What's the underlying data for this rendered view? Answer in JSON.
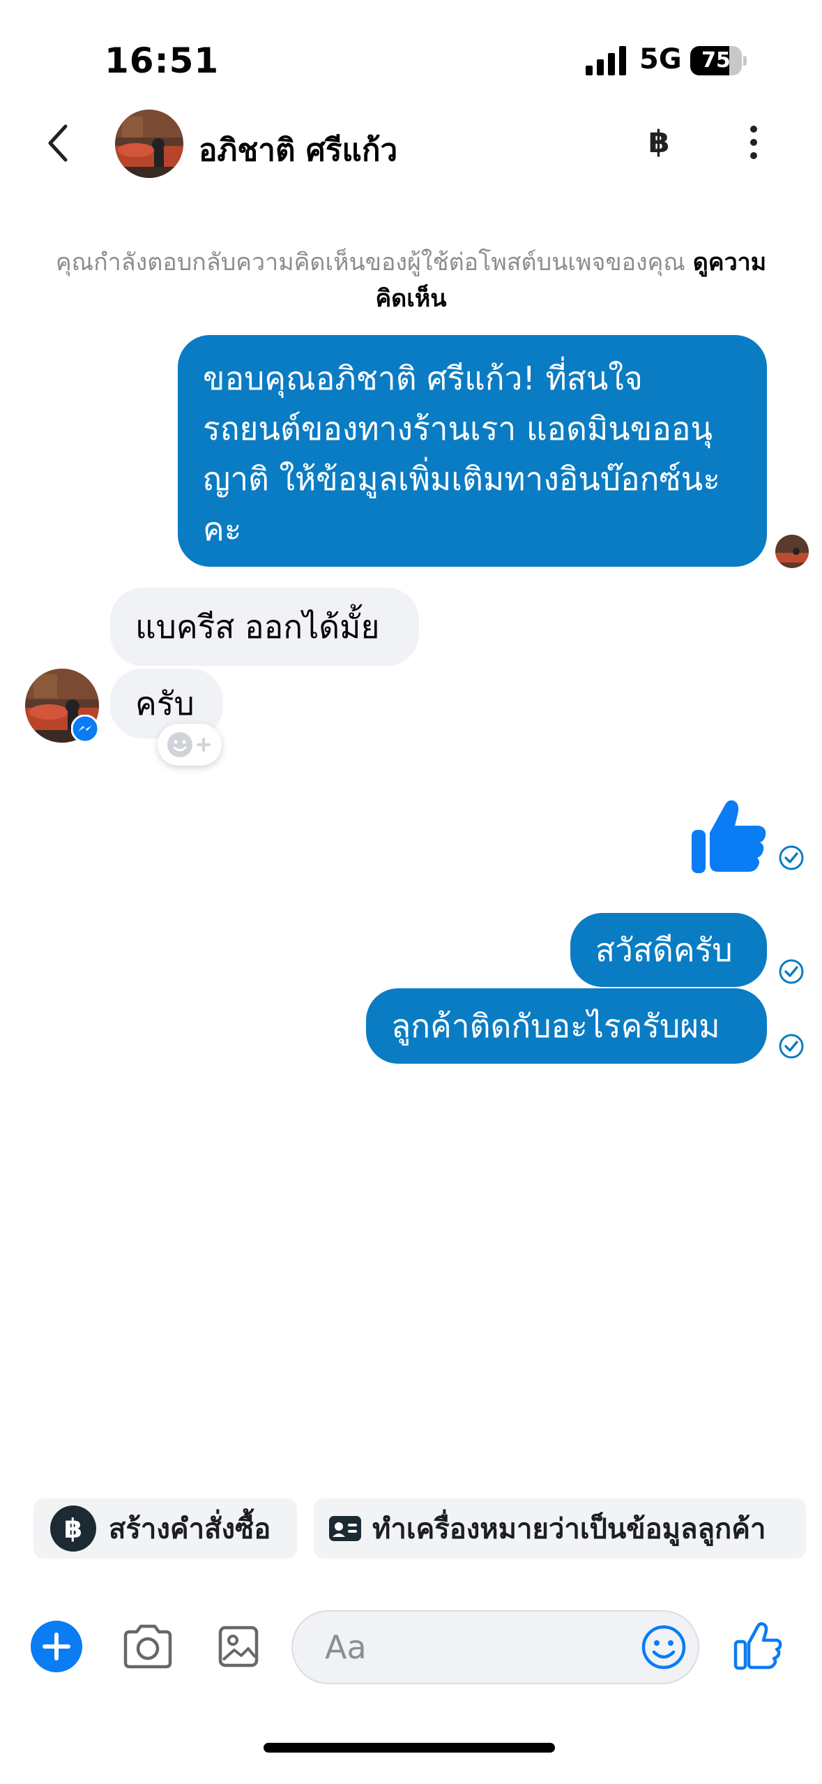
{
  "status_bar": {
    "time": "16:51",
    "network": "5G",
    "battery": "75",
    "battery_level": 0.75
  },
  "header": {
    "contact_name": "อภิชาติ ศรีแก้ว",
    "currency_symbol": "฿"
  },
  "notice": {
    "text": "คุณกำลังตอบกลับความคิดเห็นของผู้ใช้ต่อโพสต์บนเพจของคุณ ",
    "link": "ดูความคิดเห็น"
  },
  "messages": [
    {
      "direction": "outgoing",
      "text": "ขอบคุณอภิชาติ ศรีแก้ว! ที่สนใจรถยนต์ของทางร้านเรา แอดมินขออนุญาติ ให้ข้อมูลเพิ่มเติมทางอินบ๊อกซ์นะคะ",
      "lines": [
        "ขอบคุณอภิชาติ ศรีแก้ว! ที่สนใจ",
        "รถยนต์ของทางร้านเรา แอดมินขออนุ",
        "ญาติ ให้ข้อมูลเพิ่มเติมทางอินบ๊อกซ์นะ",
        "คะ"
      ]
    },
    {
      "direction": "incoming",
      "text": "แบครีส ออกได้มั้ย"
    },
    {
      "direction": "incoming",
      "text": "ครับ"
    },
    {
      "direction": "outgoing",
      "type": "like",
      "icon": "thumbs-up-icon"
    },
    {
      "direction": "outgoing",
      "text": "สวัสดีครับ"
    },
    {
      "direction": "outgoing",
      "text": "ลูกค้าติดกับอะไรครับผม"
    }
  ],
  "quick_actions": [
    {
      "label": "สร้างคำสั่งซื้อ",
      "icon": "baht-circle-icon"
    },
    {
      "label": "ทำเครื่องหมายว่าเป็นข้อมูลลูกค้า",
      "icon": "id-card-icon"
    }
  ],
  "composer": {
    "placeholder": "Aa"
  },
  "colors": {
    "accent": "#0a7cc4",
    "messenger_blue": "#0084ff",
    "incoming_bubble": "#f0f2f5"
  }
}
